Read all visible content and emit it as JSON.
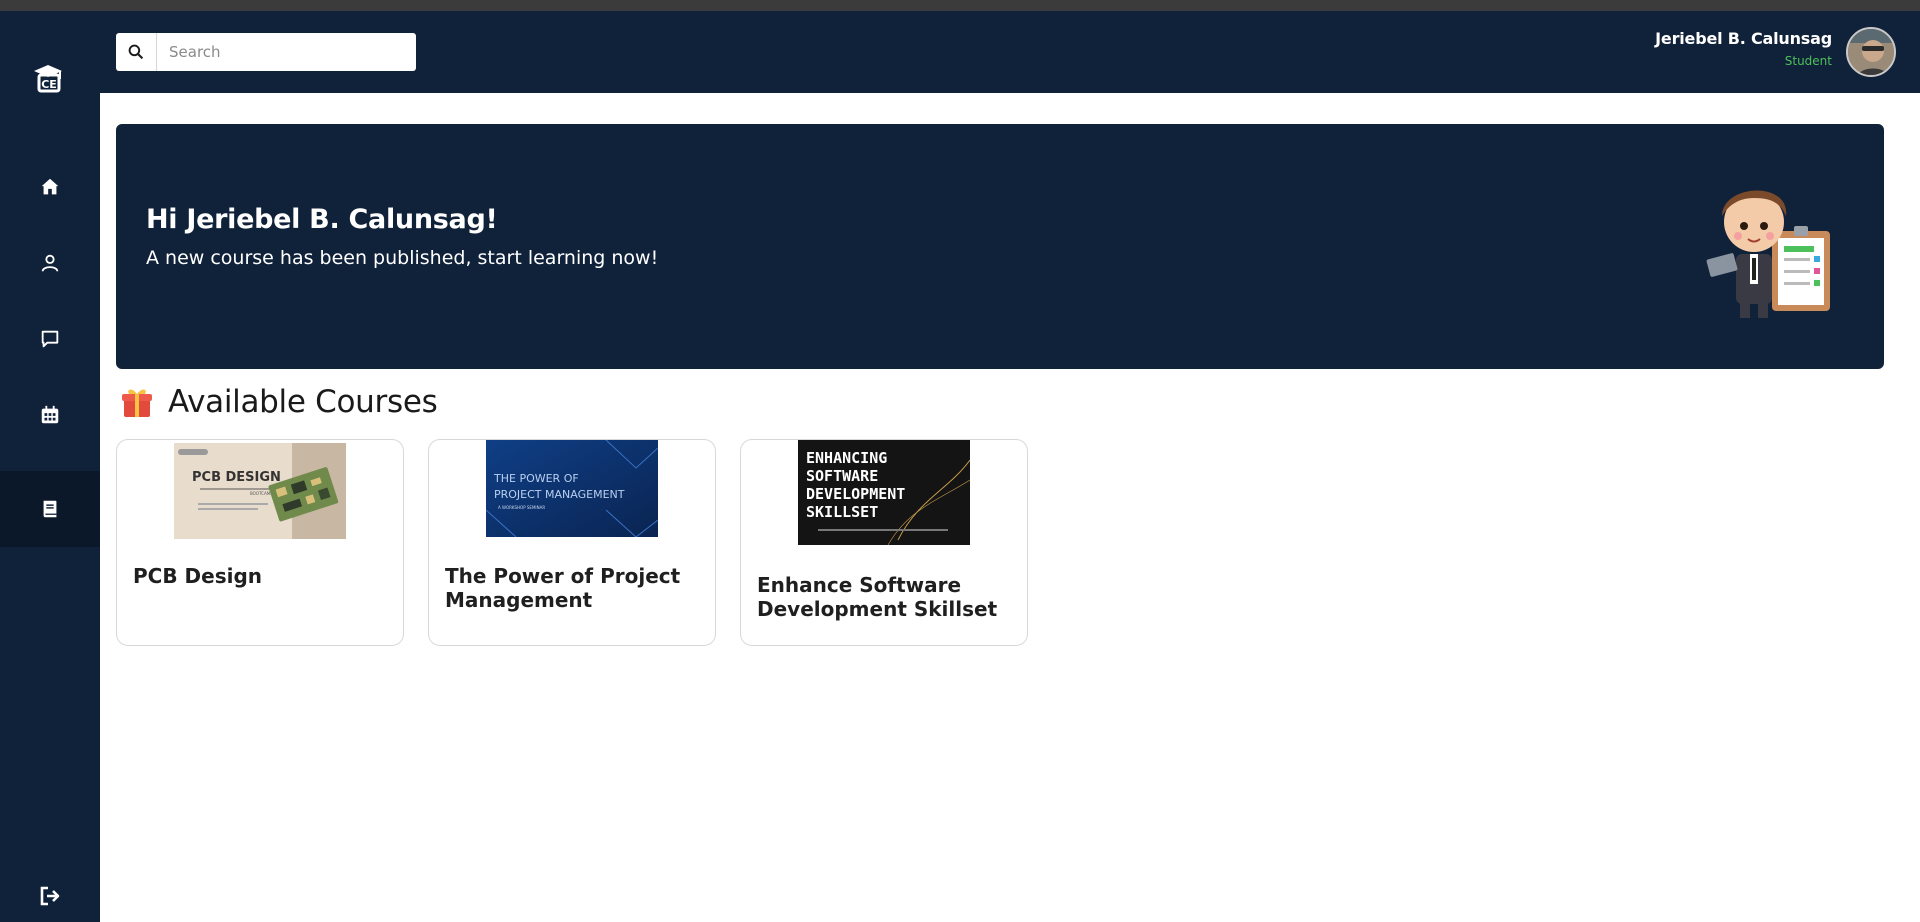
{
  "search": {
    "placeholder": "Search"
  },
  "user": {
    "name": "Jeriebel B. Calunsag",
    "role": "Student"
  },
  "banner": {
    "greeting": "Hi Jeriebel B. Calunsag!",
    "message": "A new course has been published, start learning now!"
  },
  "section": {
    "title": "Available Courses",
    "icon": "gift-icon"
  },
  "courses": [
    {
      "title": "PCB Design",
      "thumb_title": "PCB DESIGN",
      "thumb_sub": "BOOTCAMP"
    },
    {
      "title": "The Power of Project Management",
      "thumb_title": "THE POWER OF",
      "thumb_title2": "PROJECT MANAGEMENT",
      "thumb_sub": "A WORKSHOP SEMINAR"
    },
    {
      "title": "Enhance Software Development Skillset",
      "thumb_title": "ENHANCING",
      "thumb_title2": "SOFTWARE",
      "thumb_title3": "DEVELOPMENT",
      "thumb_title4": "SKILLSET"
    }
  ],
  "nav": [
    "home-icon",
    "user-icon",
    "chat-icon",
    "calendar-icon",
    "book-icon",
    "logout-icon"
  ],
  "colors": {
    "navy": "#10213a",
    "accent_green": "#4cc05a"
  }
}
